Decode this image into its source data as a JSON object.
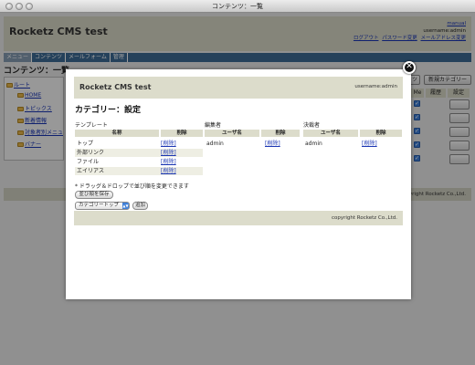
{
  "window": {
    "title": "コンテンツ：一覧"
  },
  "background": {
    "logo": "Rocketz CMS test",
    "manual_link": "manual",
    "username": "username:admin",
    "links": [
      "ログアウト",
      "パスワード変更",
      "メールアドレス変更"
    ],
    "nav": [
      "メニュー",
      "コンテンツ",
      "メールフォーム",
      "管理"
    ],
    "page_title": "コンテンツ：一覧",
    "tree": [
      "ルート",
      "HOME",
      "トピックス",
      "新着情報",
      "対象者別メニュ",
      "バナー"
    ],
    "buttons": {
      "partial": "ツ",
      "new_category": "新規カテゴリー"
    },
    "table_headers": {
      "me": "Me",
      "history": "履歴",
      "settings": "設定"
    },
    "footer": "copyright Rocketz Co.,Ltd."
  },
  "modal": {
    "logo": "Rocketz CMS test",
    "username": "username:admin",
    "title": "カテゴリー：設定",
    "template": {
      "label": "テンプレート",
      "headers": {
        "name": "名称",
        "delete": "削除"
      },
      "rows": [
        {
          "name": "トップ",
          "action": "[削除]"
        },
        {
          "name": "外部リンク",
          "action": "[削除]"
        },
        {
          "name": "ファイル",
          "action": "[削除]"
        },
        {
          "name": "エイリアス",
          "action": "[削除]"
        }
      ]
    },
    "editor": {
      "label": "編集者",
      "headers": {
        "user": "ユーザ名",
        "delete": "削除"
      },
      "rows": [
        {
          "user": "admin",
          "action": "[削除]"
        }
      ]
    },
    "approver": {
      "label": "決裁者",
      "headers": {
        "user": "ユーザ名",
        "delete": "削除"
      },
      "rows": [
        {
          "user": "admin",
          "action": "[削除]"
        }
      ]
    },
    "note": "* ドラッグ＆ドロップで並び順を変更できます",
    "save_order_button": "並び順を保存",
    "category_select": "カテゴリートップ",
    "add_button": "追加",
    "footer": "copyright Rocketz Co.,Ltd."
  }
}
